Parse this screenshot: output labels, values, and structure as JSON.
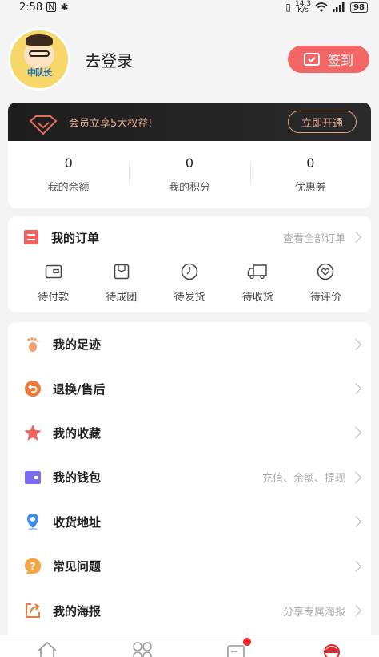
{
  "status_bar": {
    "time": "2:58",
    "net_speed": "14.3\nK/s",
    "battery": "98"
  },
  "profile": {
    "login_label": "去登录",
    "avatar_brand": "中队长",
    "checkin_label": "签到"
  },
  "vip": {
    "text": "会员立享5大权益!",
    "button": "立即开通"
  },
  "stats": [
    {
      "value": "0",
      "label": "我的余额"
    },
    {
      "value": "0",
      "label": "我的积分"
    },
    {
      "value": "0",
      "label": "优惠券"
    }
  ],
  "orders": {
    "title": "我的订单",
    "view_all": "查看全部订单",
    "items": [
      {
        "label": "待付款",
        "icon": "wallet-icon"
      },
      {
        "label": "待成团",
        "icon": "bag-icon"
      },
      {
        "label": "待发货",
        "icon": "clock-icon"
      },
      {
        "label": "待收货",
        "icon": "truck-icon"
      },
      {
        "label": "待评价",
        "icon": "heart-comment-icon"
      }
    ]
  },
  "menu": [
    {
      "label": "我的足迹",
      "hint": "",
      "icon": "footprint-icon",
      "color": "#f3a46b"
    },
    {
      "label": "退换/售后",
      "hint": "",
      "icon": "return-icon",
      "color": "#f07a3a"
    },
    {
      "label": "我的收藏",
      "hint": "",
      "icon": "star-icon",
      "color": "#f0605f"
    },
    {
      "label": "我的钱包",
      "hint": "充值、余额、提现",
      "icon": "wallet-purple-icon",
      "color": "#7b6cf0"
    },
    {
      "label": "收货地址",
      "hint": "",
      "icon": "location-icon",
      "color": "#3f8cf0"
    },
    {
      "label": "常见问题",
      "hint": "",
      "icon": "question-icon",
      "color": "#f3a546"
    },
    {
      "label": "我的海报",
      "hint": "分享专属海报",
      "icon": "share-icon",
      "color": "#f07a3a"
    }
  ],
  "colors": {
    "accent": "#f26665",
    "vip_text": "#e9b19a",
    "badge": "#f0212b"
  }
}
